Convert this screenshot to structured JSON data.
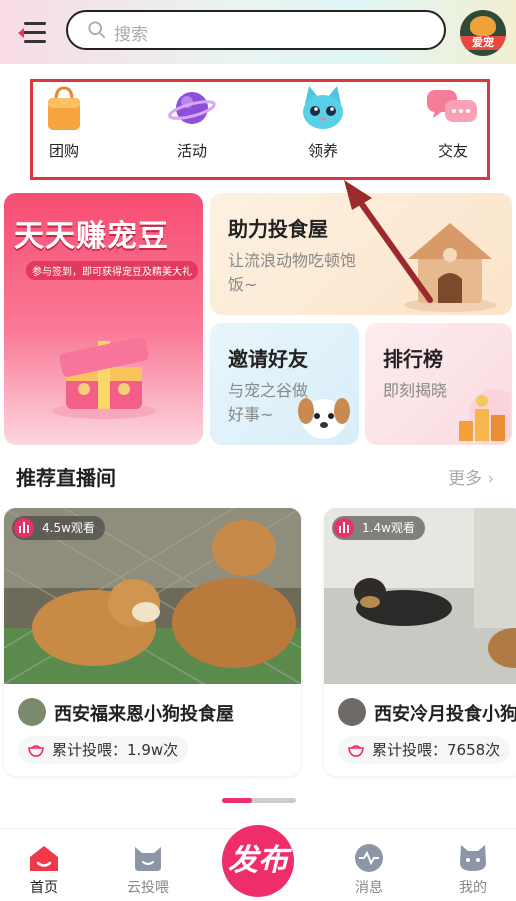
{
  "header": {
    "search_placeholder": "搜索",
    "avatar_badge": "爱宠"
  },
  "categories": [
    {
      "label": "团购",
      "icon": "shopping-bag-icon"
    },
    {
      "label": "活动",
      "icon": "planet-icon"
    },
    {
      "label": "领养",
      "icon": "cat-icon"
    },
    {
      "label": "交友",
      "icon": "chat-bubbles-icon"
    }
  ],
  "promo": {
    "main_title": "天天赚宠豆",
    "main_subtitle": "参与签到，即可获得宠豆及精美大礼",
    "cards": [
      {
        "title": "助力投食屋",
        "subtitle": "让流浪动物吃顿饱饭~"
      },
      {
        "title": "邀请好友",
        "subtitle": "与宠之谷做好事~"
      },
      {
        "title": "排行榜",
        "subtitle": "即刻揭晓"
      }
    ]
  },
  "live": {
    "section_title": "推荐直播间",
    "more_label": "更多",
    "rooms": [
      {
        "viewers": "4.5w观看",
        "name": "西安福来恩小狗投食屋",
        "feed_label": "累计投喂：",
        "feed_count": "1.9w次"
      },
      {
        "viewers": "1.4w观看",
        "name": "西安冷月投食小狗",
        "feed_label": "累计投喂：",
        "feed_count": "7658次"
      }
    ]
  },
  "tabbar": {
    "items": [
      {
        "label": "首页",
        "icon": "home-icon",
        "active": true
      },
      {
        "label": "云投喂",
        "icon": "cat-face-icon"
      },
      {
        "label": "发布",
        "icon": "publish-button"
      },
      {
        "label": "消息",
        "icon": "message-icon"
      },
      {
        "label": "我的",
        "icon": "profile-icon"
      }
    ]
  },
  "colors": {
    "accent": "#ee2d6a",
    "highlight_frame": "#d9383e"
  }
}
